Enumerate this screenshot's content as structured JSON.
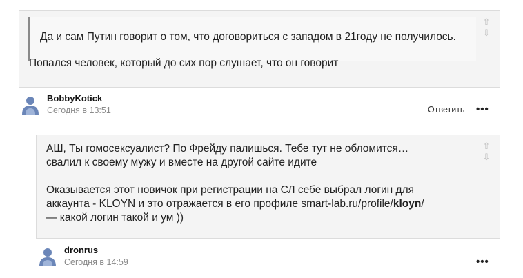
{
  "comment1": {
    "quote": "Да и сам Путин говорит о том, что договориться с западом в 21году не получилось.",
    "reply": "Попался человек, который до сих пор слушает, что он говорит"
  },
  "author1": {
    "username": "BobbyKotick",
    "timestamp": "Сегодня в 13:51",
    "reply_label": "Ответить",
    "more_label": "•••"
  },
  "comment2": {
    "line1": "АШ, Ты гомосексуалист? По Фрейду палишься.  Тебе тут не обломится…",
    "line2": "свалил к своему мужу и вместе на другой сайте идите",
    "line3": "Оказывается этот новичок при регистрации на СЛ себе выбрал логин для",
    "line4_prefix": "аккаунта -  KLOYN и это отражается в его профиле  smart-lab.ru/profile/",
    "line4_bold": "kloyn",
    "line4_suffix": "/",
    "line5": "— какой логин такой и ум ))"
  },
  "author2": {
    "username": "dronrus",
    "timestamp": "Сегодня в 14:59",
    "more_label": "•••"
  },
  "icons": {
    "vote_up": "⇧",
    "vote_down": "⇩"
  },
  "colors": {
    "box_bg": "#f4f4f4",
    "quote_border": "#8a8a8a",
    "avatar": "#6b86b8"
  }
}
